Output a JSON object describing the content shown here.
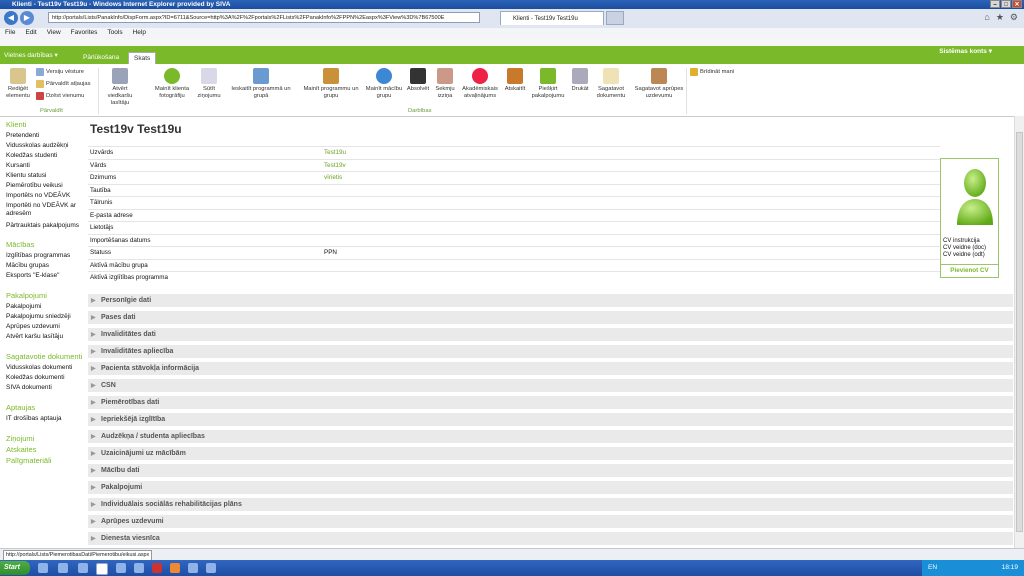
{
  "window": {
    "title": "Klienti - Test19v Test19u - Windows Internet Explorer provided by SIVA"
  },
  "browser": {
    "url": "http://portals/Lists/PanakInfo/DispForm.aspx?ID=6711&Source=http%3A%2F%2Fportals%2FLists%2FPanakInfo%2FPPN%2Easpx%3FView%3D%7B67500E",
    "tab_title": "Klienti - Test19v Test19u",
    "menu": [
      "File",
      "Edit",
      "View",
      "Favorites",
      "Tools",
      "Help"
    ],
    "status_url": "http://portals/Lists/PiemerotibasDati/Piemerotibu/eikusi.aspx"
  },
  "ribbon": {
    "site_actions": "Vietnes darbības ▾",
    "tabs": [
      "Pārlūkošana",
      "Skats"
    ],
    "system_account": "Sistēmas konts ▾",
    "group_edit": "Pārvaldīt",
    "group_actions": "Darbības",
    "edit_item": "Rediģēt elementu",
    "version_history": "Versiju vēsture",
    "manage_permissions": "Pārvaldīt atļaujas",
    "delete_item": "Dzēst vienumu",
    "buttons": [
      "Atvērt viedkaršu lasītāju",
      "Mainīt klienta fotogrāfiju",
      "Sūtīt ziņojumu",
      "Ieskaitīt programmā un grupā",
      "Mainīt programmu un grupu",
      "Mainīt mācību grupu",
      "Absolvēt",
      "Sekmju izziņa",
      "Akadēmiskais atvaļinājums",
      "Atskaitīt",
      "Piešķirt pakalpojumu",
      "Drukāt",
      "Sagatavot dokumentu",
      "Sagatavot aprūpes uzdevumu"
    ],
    "alert_me": "Brīdināt mani"
  },
  "leftnav": [
    {
      "heading": "Klienti",
      "items": [
        "Pretendenti",
        "Vidusskolas audzēkņi",
        "Koledžas studenti",
        "Kursanti",
        "Klientu statusi",
        "Piemērotību veikusi",
        "Importēts no VDEĀVK",
        "Importēti no VDEĀVK ar adresēm",
        "Pārtrauktais pakalpojums"
      ]
    },
    {
      "heading": "Mācības",
      "items": [
        "Izglītības programmas",
        "Mācību grupas",
        "Eksports \"E-klase\""
      ]
    },
    {
      "heading": "Pakalpojumi",
      "items": [
        "Pakalpojumi",
        "Pakalpojumu sniedzēji",
        "Aprūpes uzdevumi",
        "Atvērt karšu lasītāju"
      ]
    },
    {
      "heading": "Sagatavotie dokumenti",
      "items": [
        "Vidusskolas dokumenti",
        "Koledžas dokumenti",
        "SIVA dokumenti"
      ]
    },
    {
      "heading": "Aptaujas",
      "items": [
        "IT drošības aptauja"
      ]
    },
    {
      "heading": "Ziņojumi",
      "items": []
    },
    {
      "heading": "Atskaites",
      "items": []
    },
    {
      "heading": "Palīgmateriāli",
      "items": []
    }
  ],
  "main": {
    "title": "Test19v Test19u",
    "fields": [
      {
        "label": "Uzvārds",
        "value": "Test19u",
        "link": true
      },
      {
        "label": "Vārds",
        "value": "Test19v",
        "link": true
      },
      {
        "label": "Dzimums",
        "value": "vīrietis",
        "link": true
      },
      {
        "label": "Tautība",
        "value": ""
      },
      {
        "label": "Tālrunis",
        "value": ""
      },
      {
        "label": "E-pasta adrese",
        "value": ""
      },
      {
        "label": "Lietotājs",
        "value": ""
      },
      {
        "label": "Importēšanas datums",
        "value": ""
      },
      {
        "label": "Statuss",
        "value": "PPN",
        "link": false
      },
      {
        "label": "Aktīvā mācību grupa",
        "value": ""
      },
      {
        "label": "Aktīvā izglītības programma",
        "value": ""
      }
    ],
    "cv": [
      "CV instrukcija",
      "CV veidne (doc)",
      "CV veidne (odt)"
    ],
    "add_cv": "Pievienot CV",
    "sections": [
      "Personīgie dati",
      "Pases dati",
      "Invaliditātes dati",
      "Invaliditātes apliecība",
      "Pacienta stāvokļa informācija",
      "CSN",
      "Piemērotības dati",
      "Iepriekšējā izglītība",
      "Audzēkņa / studenta apliecības",
      "Uzaicinājumi uz mācībām",
      "Mācību dati",
      "Pakalpojumi",
      "Individuālais sociālās rehabilitācijas plāns",
      "Aprūpes uzdevumi",
      "Dienesta viesnīca"
    ]
  },
  "taskbar": {
    "start": "Start",
    "lang": "EN",
    "clock": "18:19"
  },
  "colors": {
    "accent": "#7ab929",
    "link": "#6aa123"
  }
}
